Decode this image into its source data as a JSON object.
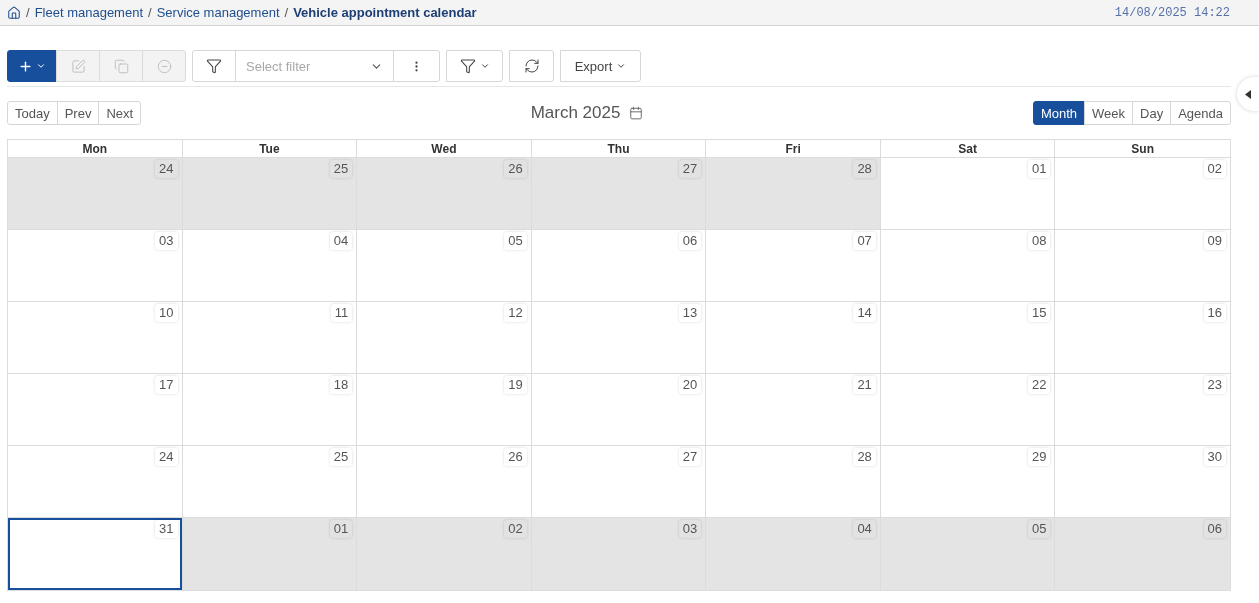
{
  "breadcrumb": {
    "separator": "/",
    "items": [
      {
        "label": "Fleet management",
        "current": false
      },
      {
        "label": "Service management",
        "current": false
      },
      {
        "label": "Vehicle appointment calendar",
        "current": true
      }
    ]
  },
  "timestamp": "14/08/2025 14:22",
  "toolbar": {
    "record_actions": [
      {
        "kind": "add",
        "primary": true,
        "disabled": false,
        "dropdown": true
      },
      {
        "kind": "edit",
        "primary": false,
        "disabled": true,
        "dropdown": false
      },
      {
        "kind": "copy",
        "primary": false,
        "disabled": true,
        "dropdown": false
      },
      {
        "kind": "delete",
        "primary": false,
        "disabled": true,
        "dropdown": false
      }
    ],
    "filter": {
      "placeholder": "Select filter"
    },
    "export": {
      "label": "Export"
    }
  },
  "calendar": {
    "nav": [
      "Today",
      "Prev",
      "Next"
    ],
    "title": "March 2025",
    "views": [
      {
        "label": "Month",
        "selected": true
      },
      {
        "label": "Week",
        "selected": false
      },
      {
        "label": "Day",
        "selected": false
      },
      {
        "label": "Agenda",
        "selected": false
      }
    ],
    "weekdays": [
      "Mon",
      "Tue",
      "Wed",
      "Thu",
      "Fri",
      "Sat",
      "Sun"
    ],
    "weeks": [
      {
        "days": [
          {
            "day": "24",
            "outside": true,
            "selected": false
          },
          {
            "day": "25",
            "outside": true,
            "selected": false
          },
          {
            "day": "26",
            "outside": true,
            "selected": false
          },
          {
            "day": "27",
            "outside": true,
            "selected": false
          },
          {
            "day": "28",
            "outside": true,
            "selected": false
          },
          {
            "day": "01",
            "outside": false,
            "selected": false
          },
          {
            "day": "02",
            "outside": false,
            "selected": false
          }
        ]
      },
      {
        "days": [
          {
            "day": "03",
            "outside": false,
            "selected": false
          },
          {
            "day": "04",
            "outside": false,
            "selected": false
          },
          {
            "day": "05",
            "outside": false,
            "selected": false
          },
          {
            "day": "06",
            "outside": false,
            "selected": false
          },
          {
            "day": "07",
            "outside": false,
            "selected": false
          },
          {
            "day": "08",
            "outside": false,
            "selected": false
          },
          {
            "day": "09",
            "outside": false,
            "selected": false
          }
        ]
      },
      {
        "days": [
          {
            "day": "10",
            "outside": false,
            "selected": false
          },
          {
            "day": "11",
            "outside": false,
            "selected": false
          },
          {
            "day": "12",
            "outside": false,
            "selected": false
          },
          {
            "day": "13",
            "outside": false,
            "selected": false
          },
          {
            "day": "14",
            "outside": false,
            "selected": false
          },
          {
            "day": "15",
            "outside": false,
            "selected": false
          },
          {
            "day": "16",
            "outside": false,
            "selected": false
          }
        ]
      },
      {
        "days": [
          {
            "day": "17",
            "outside": false,
            "selected": false
          },
          {
            "day": "18",
            "outside": false,
            "selected": false
          },
          {
            "day": "19",
            "outside": false,
            "selected": false
          },
          {
            "day": "20",
            "outside": false,
            "selected": false
          },
          {
            "day": "21",
            "outside": false,
            "selected": false
          },
          {
            "day": "22",
            "outside": false,
            "selected": false
          },
          {
            "day": "23",
            "outside": false,
            "selected": false
          }
        ]
      },
      {
        "days": [
          {
            "day": "24",
            "outside": false,
            "selected": false
          },
          {
            "day": "25",
            "outside": false,
            "selected": false
          },
          {
            "day": "26",
            "outside": false,
            "selected": false
          },
          {
            "day": "27",
            "outside": false,
            "selected": false
          },
          {
            "day": "28",
            "outside": false,
            "selected": false
          },
          {
            "day": "29",
            "outside": false,
            "selected": false
          },
          {
            "day": "30",
            "outside": false,
            "selected": false
          }
        ]
      },
      {
        "days": [
          {
            "day": "31",
            "outside": false,
            "selected": true
          },
          {
            "day": "01",
            "outside": true,
            "selected": false
          },
          {
            "day": "02",
            "outside": true,
            "selected": false
          },
          {
            "day": "03",
            "outside": true,
            "selected": false
          },
          {
            "day": "04",
            "outside": true,
            "selected": false
          },
          {
            "day": "05",
            "outside": true,
            "selected": false
          },
          {
            "day": "06",
            "outside": true,
            "selected": false
          }
        ]
      }
    ]
  }
}
